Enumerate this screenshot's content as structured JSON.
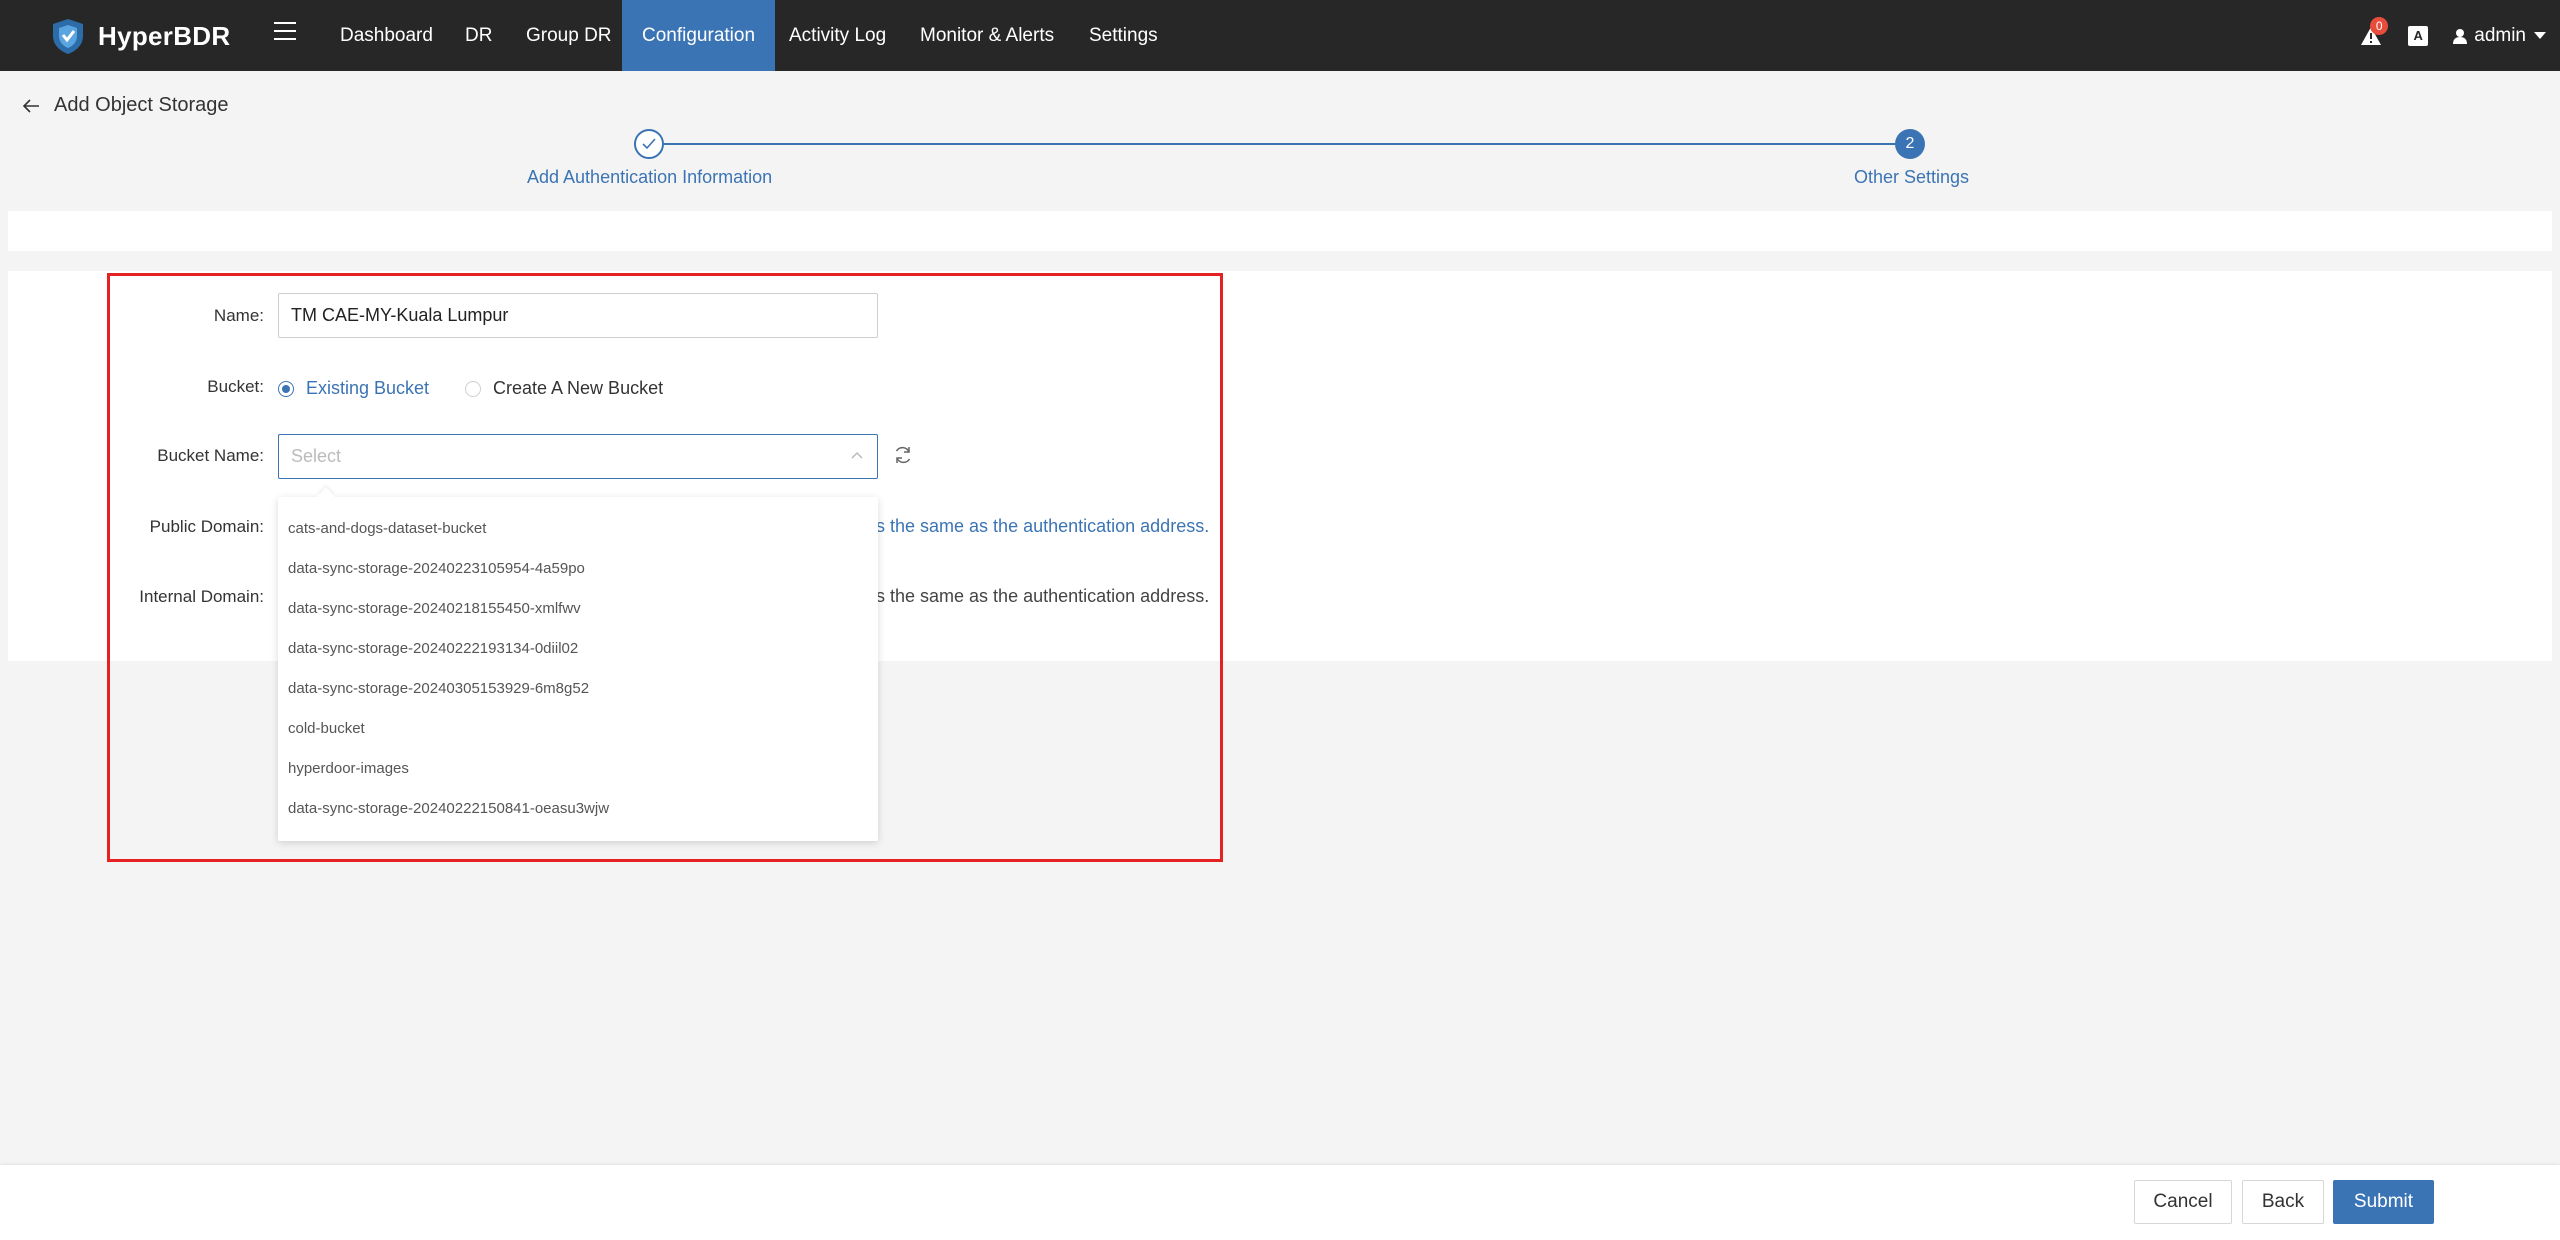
{
  "app": {
    "name": "HyperBDR"
  },
  "nav": {
    "items": [
      "Dashboard",
      "DR",
      "Group DR",
      "Configuration",
      "Activity Log",
      "Monitor & Alerts",
      "Settings"
    ],
    "active": "Configuration",
    "alert_count": "0",
    "lang_icon": "A",
    "user": "admin"
  },
  "page": {
    "title": "Add Object Storage"
  },
  "steps": [
    {
      "label": "Add Authentication Information",
      "status": "done"
    },
    {
      "number": "2",
      "label": "Other Settings",
      "status": "current"
    }
  ],
  "form": {
    "name_label": "Name:",
    "name_value": "TM CAE-MY-Kuala Lumpur",
    "bucket_label": "Bucket:",
    "bucket_option_existing": "Existing Bucket",
    "bucket_option_new": "Create A New Bucket",
    "bucket_name_label": "Bucket Name:",
    "bucket_name_placeholder": "Select",
    "public_domain_label": "Public Domain:",
    "public_domain_hint": "is the same as the authentication address.",
    "internal_domain_label": "Internal Domain:",
    "internal_domain_hint": "is the same as the authentication address."
  },
  "dropdown": {
    "options": [
      "cats-and-dogs-dataset-bucket",
      "data-sync-storage-20240223105954-4a59po",
      "data-sync-storage-20240218155450-xmlfwv",
      "data-sync-storage-20240222193134-0diil02",
      "data-sync-storage-20240305153929-6m8g52",
      "cold-bucket",
      "hyperdoor-images",
      "data-sync-storage-20240222150841-oeasu3wjw"
    ]
  },
  "footer": {
    "cancel": "Cancel",
    "back": "Back",
    "submit": "Submit"
  },
  "colors": {
    "navbar": "#272727",
    "accent": "#3b74b4",
    "highlight": "#e52222",
    "badge": "#e74c3c"
  }
}
